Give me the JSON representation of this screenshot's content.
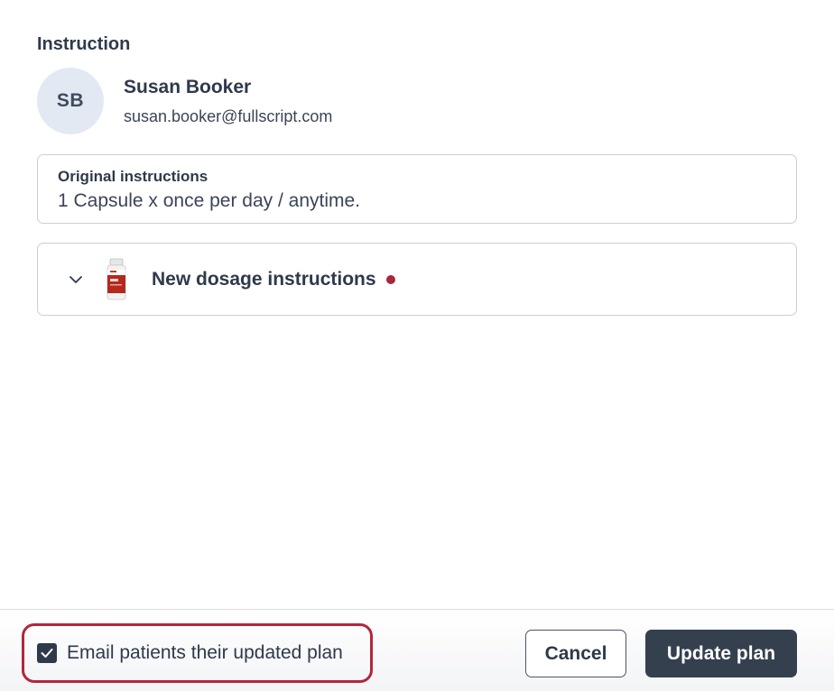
{
  "section": {
    "title": "Instruction"
  },
  "patient": {
    "initials": "SB",
    "name": "Susan Booker",
    "email": "susan.booker@fullscript.com"
  },
  "original_instructions": {
    "label": "Original instructions",
    "text": "1 Capsule x once per day / anytime."
  },
  "dosage": {
    "label": "New dosage instructions",
    "expand_icon": "chevron-down-icon",
    "required_indicator_color": "#a8273a"
  },
  "footer": {
    "email_option": {
      "label": "Email patients their updated plan",
      "checked": true
    },
    "cancel_label": "Cancel",
    "update_label": "Update plan"
  },
  "colors": {
    "primary": "#35404f",
    "highlight_border": "#b3263d",
    "avatar_bg": "#e3e9f2"
  }
}
